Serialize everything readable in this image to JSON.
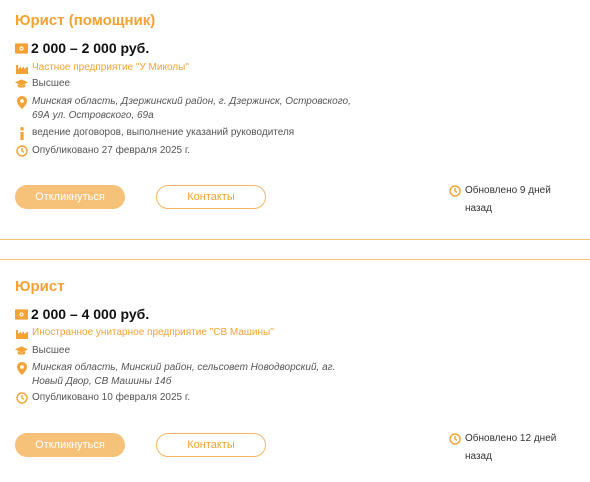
{
  "colors": {
    "accent": "#f3a233",
    "apply_bg": "#f6c27a",
    "separator": "#f2c278",
    "salary_text": "#111111"
  },
  "vacancies": [
    {
      "title": "Юрист (помощник)",
      "salary": "2 000 – 2 000 руб.",
      "company": "Частное предприятие \"У Миколы\"",
      "education": "Высшее",
      "address": "Минская область, Дзержинский район, г. Дзержинск, Островского, 69А ул. Островского, 69а",
      "description": "ведение договоров, выполнение указаний руководителя",
      "published": "Опубликовано 27 февраля 2025 г.",
      "apply_label": "Откликнуться",
      "contacts_label": "Контакты",
      "updated": "Обновлено 9 дней назад"
    },
    {
      "title": "Юрист",
      "salary": "2 000 – 4 000 руб.",
      "company": "Иностранное унитарное предприятие \"СВ Машины\"",
      "education": "Высшее",
      "address": "Минская область, Минский район, сельсовет Новодворский, аг. Новый Двор, СВ Машины 14б",
      "published": "Опубликовано 10 февраля 2025 г.",
      "apply_label": "Откликнуться",
      "contacts_label": "Контакты",
      "updated": "Обновлено 12 дней назад"
    }
  ]
}
